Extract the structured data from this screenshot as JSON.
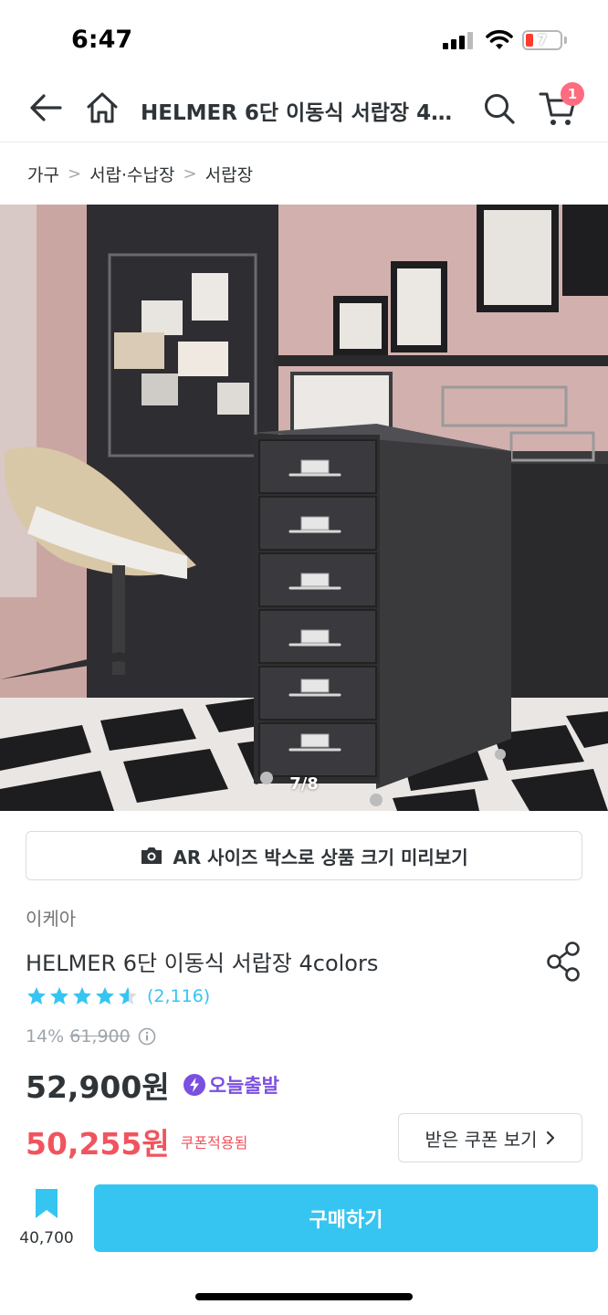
{
  "status_bar": {
    "time": "6:47",
    "battery": "7"
  },
  "nav": {
    "title": "HELMER 6단 이동식 서랍장 4colors",
    "cart_badge": "1",
    "icons": [
      "back-arrow-icon",
      "home-icon",
      "search-icon",
      "cart-icon"
    ]
  },
  "breadcrumb": {
    "items": [
      "가구",
      "서랍·수납장",
      "서랍장"
    ]
  },
  "gallery": {
    "counter": "7/8"
  },
  "ar_button": {
    "label": "AR 사이즈 박스로 상품 크기 미리보기"
  },
  "product": {
    "brand": "이케아",
    "title": "HELMER 6단 이동식 서랍장 4colors",
    "rating": 4.5,
    "review_count": "(2,116)",
    "discount_rate": "14%",
    "original_price": "61,900",
    "price": "52,900원",
    "delivery_badge": "오늘출발",
    "coupon_price": "50,255원",
    "coupon_applied_label": "쿠폰적용됨",
    "coupon_button": "받은 쿠폰 보기"
  },
  "bottom_bar": {
    "bookmark_count": "40,700",
    "buy_label": "구매하기"
  },
  "colors": {
    "accent": "#35c5f0",
    "sale_red": "#f0545e",
    "today_purple": "#7b4fe0",
    "cart_badge": "#ff6b7f"
  }
}
